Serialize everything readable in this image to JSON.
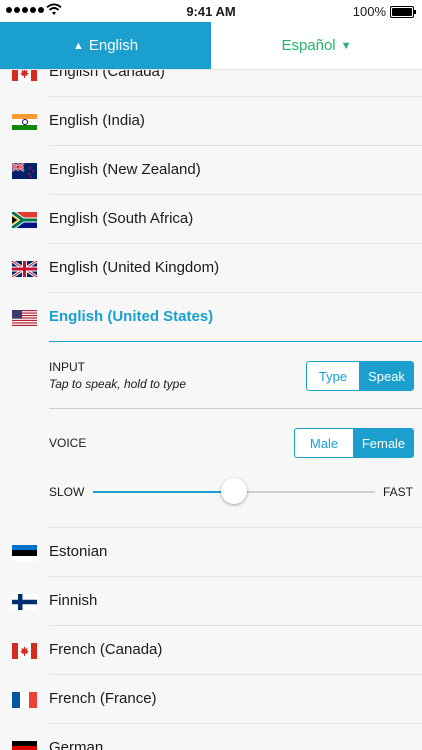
{
  "status_bar": {
    "time": "9:41 AM",
    "battery": "100%",
    "signal_icon": "signal-dots-icon",
    "wifi_icon": "wifi-icon",
    "battery_icon": "battery-icon"
  },
  "tabs": {
    "left": {
      "label": "English",
      "arrow": "▲"
    },
    "right": {
      "label": "Español",
      "arrow": "▼"
    }
  },
  "languages_top": [
    {
      "label": "English (Canada)",
      "flag": "canada-flag-icon"
    },
    {
      "label": "English (India)",
      "flag": "india-flag-icon"
    },
    {
      "label": "English (New Zealand)",
      "flag": "new-zealand-flag-icon"
    },
    {
      "label": "English (South Africa)",
      "flag": "south-africa-flag-icon"
    },
    {
      "label": "English (United Kingdom)",
      "flag": "united-kingdom-flag-icon"
    },
    {
      "label": "English (United States)",
      "flag": "united-states-flag-icon",
      "selected": true
    }
  ],
  "input_setting": {
    "title": "INPUT",
    "subtitle": "Tap to speak, hold to type",
    "options": [
      "Type",
      "Speak"
    ],
    "selected": "Speak"
  },
  "voice_setting": {
    "title": "VOICE",
    "options": [
      "Male",
      "Female"
    ],
    "selected": "Female"
  },
  "speed": {
    "slow_label": "SLOW",
    "fast_label": "FAST",
    "value": 0.5
  },
  "languages_bottom": [
    {
      "label": "Estonian",
      "flag": "estonia-flag-icon"
    },
    {
      "label": "Finnish",
      "flag": "finland-flag-icon"
    },
    {
      "label": "French (Canada)",
      "flag": "canada-flag-icon"
    },
    {
      "label": "French (France)",
      "flag": "france-flag-icon"
    },
    {
      "label": "German",
      "flag": "germany-flag-icon"
    }
  ],
  "colors": {
    "accent": "#1a9fcf",
    "green": "#25b46b"
  }
}
